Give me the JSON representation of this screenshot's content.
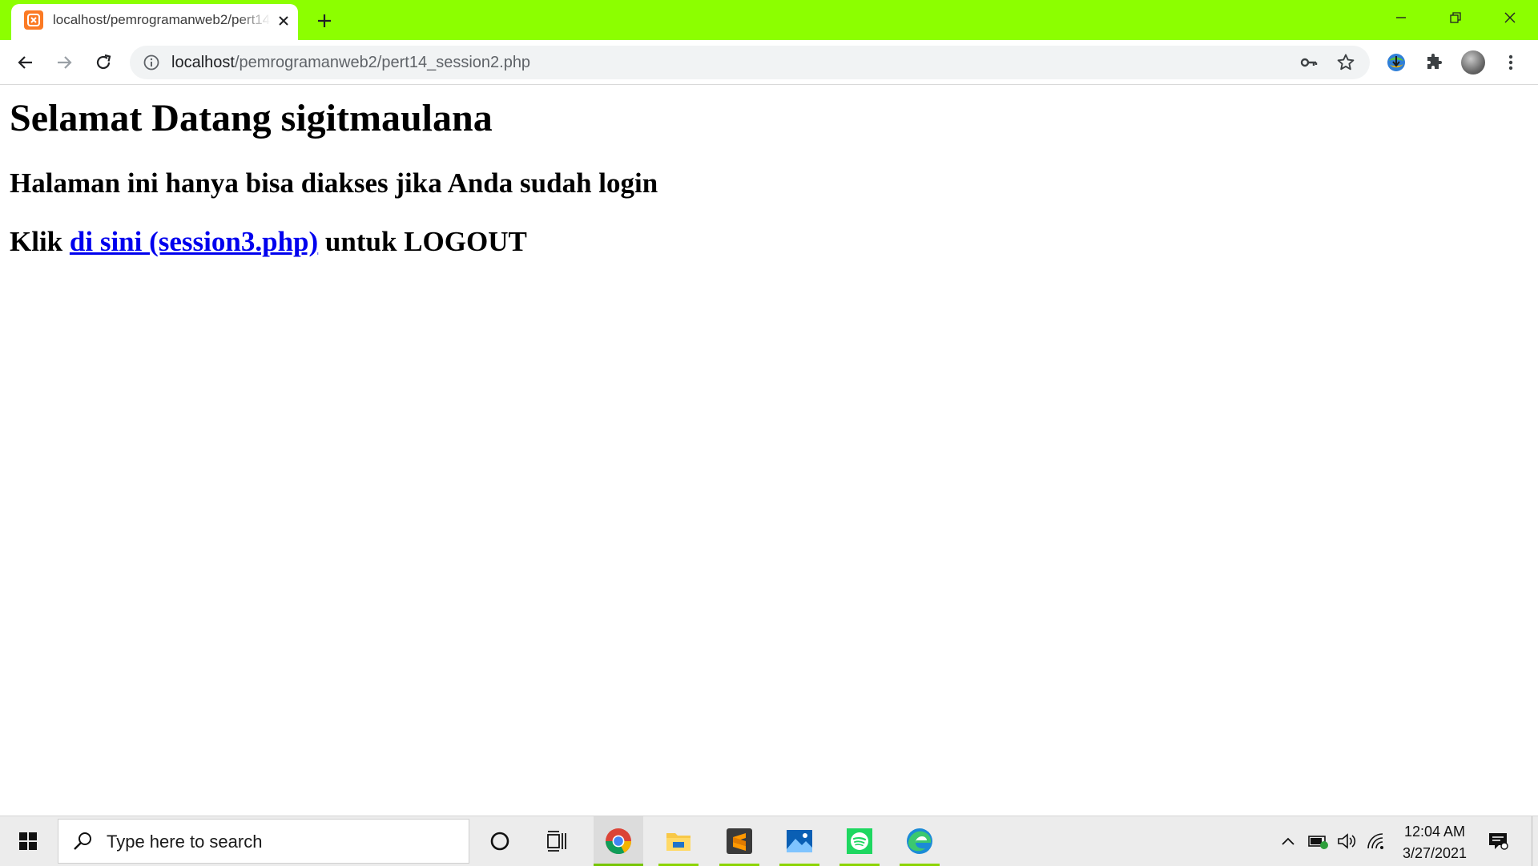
{
  "browser": {
    "tab": {
      "title": "localhost/pemrogramanweb2/pert14_session2.php",
      "favicon": "xampp-icon"
    },
    "address_bar": {
      "host": "localhost",
      "path": "/pemrogramanweb2/pert14_session2.php"
    },
    "theme_color": "#8cff00"
  },
  "page": {
    "heading": "Selamat Datang sigitmaulana",
    "subheading": "Halaman ini hanya bisa diakses jika Anda sudah login",
    "logout_prefix": "Klik ",
    "logout_link": "di sini (session3.php)",
    "logout_suffix": " untuk LOGOUT",
    "link_color": "#0000ee"
  },
  "taskbar": {
    "search_placeholder": "Type here to search",
    "pinned_apps": [
      "chrome-icon",
      "file-explorer-icon",
      "sublime-text-icon",
      "photos-icon",
      "spotify-icon",
      "edge-icon"
    ],
    "tray_icons": [
      "chevron-up-icon",
      "battery-icon",
      "volume-icon",
      "wifi-icon"
    ],
    "clock": {
      "time": "12:04 AM",
      "date": "3/27/2021"
    },
    "accent_color": "#8cd400"
  }
}
